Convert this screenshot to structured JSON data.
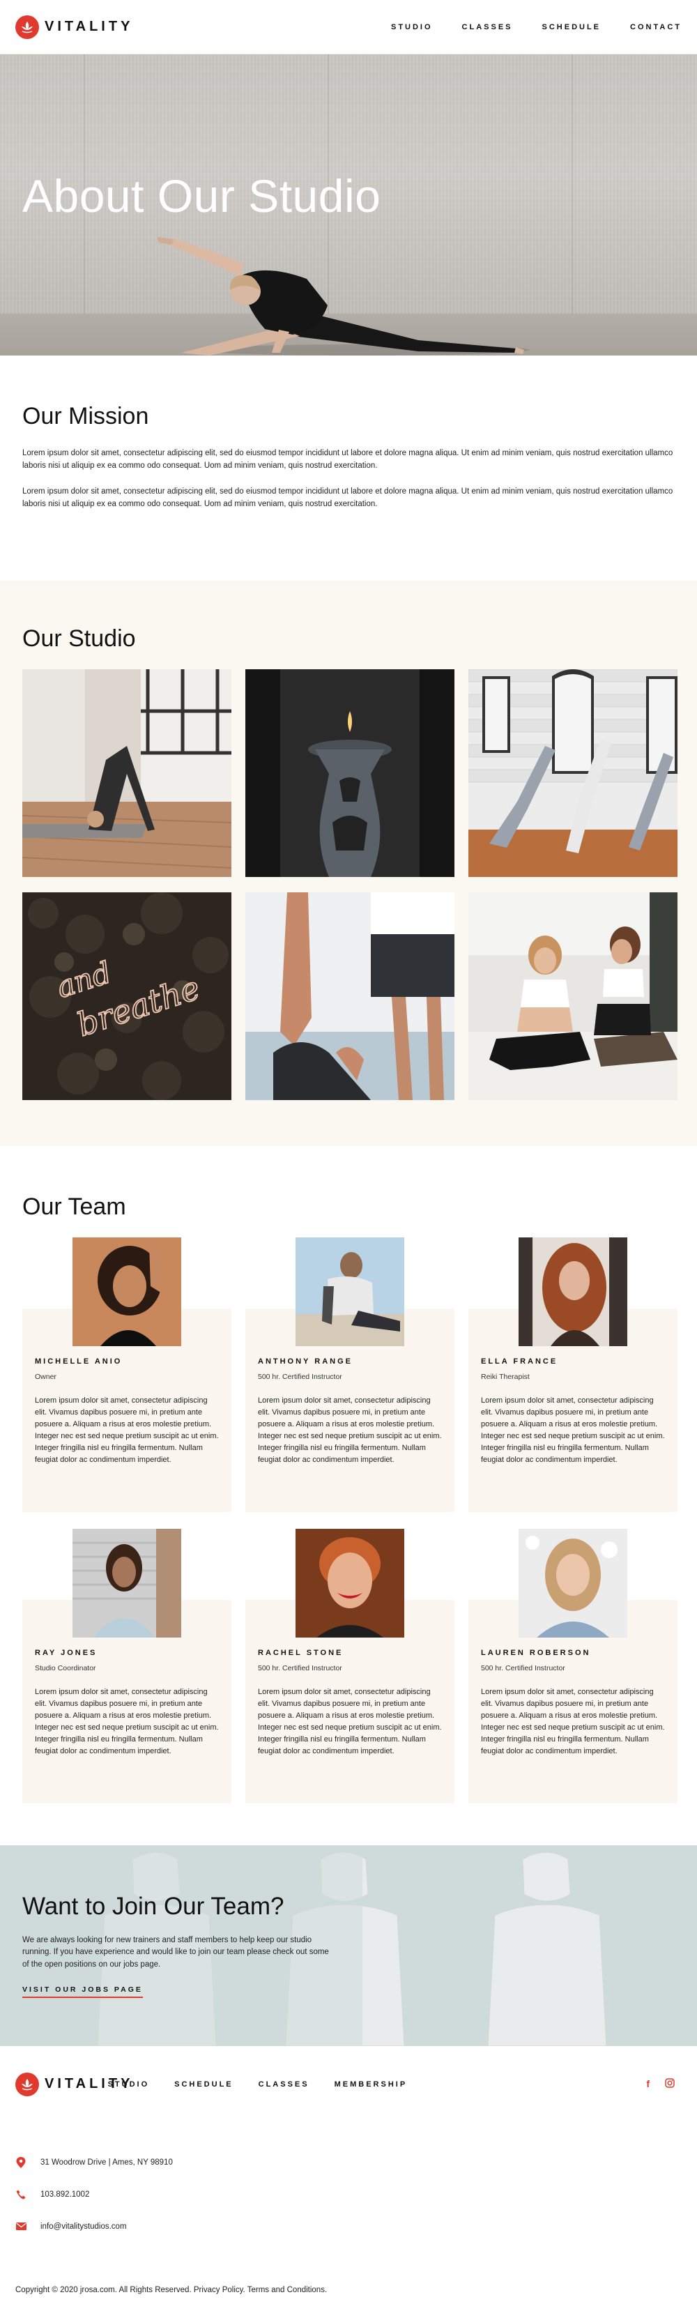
{
  "header": {
    "brand": "VITALITY",
    "nav": [
      "STUDIO",
      "CLASSES",
      "SCHEDULE",
      "CONTACT"
    ]
  },
  "hero": {
    "title": "About Our Studio"
  },
  "mission": {
    "title": "Our Mission",
    "paragraphs": [
      "Lorem ipsum dolor sit amet, consectetur adipiscing elit, sed do eiusmod tempor incididunt ut labore et dolore magna aliqua. Ut enim ad minim veniam, quis nostrud exercitation ullamco laboris nisi ut aliquip ex ea commo odo consequat. Uom ad minim veniam, quis nostrud exercitation.",
      "Lorem ipsum dolor sit amet, consectetur adipiscing elit, sed do eiusmod tempor incididunt ut labore et dolore magna aliqua. Ut enim ad minim veniam, quis nostrud exercitation ullamco laboris nisi ut aliquip ex ea commo odo consequat. Uom ad minim veniam, quis nostrud exercitation."
    ]
  },
  "studio": {
    "title": "Our Studio",
    "photos": [
      "downward-dog-yoga",
      "candle-holder",
      "handstand-class",
      "and-breathe-neon-sign",
      "partner-stretch",
      "women-stretching"
    ],
    "neon": [
      "and",
      "breathe"
    ]
  },
  "team": {
    "title": "Our Team",
    "bio": "Lorem ipsum dolor sit amet, consectetur adipiscing elit. Vivamus dapibus posuere mi, in pretium ante posuere a. Aliquam a risus at eros molestie pretium. Integer nec est sed neque pretium suscipit ac ut enim. Integer fringilla nisl eu fringilla fermentum. Nullam feugiat dolor ac condimentum imperdiet.",
    "members": [
      {
        "name": "MICHELLE ANIO",
        "role": "Owner"
      },
      {
        "name": "ANTHONY RANGE",
        "role": "500 hr. Certified Instructor"
      },
      {
        "name": "ELLA FRANCE",
        "role": "Reiki Therapist"
      },
      {
        "name": "RAY JONES",
        "role": "Studio Coordinator"
      },
      {
        "name": "RACHEL STONE",
        "role": "500 hr. Certified Instructor"
      },
      {
        "name": "LAUREN ROBERSON",
        "role": "500 hr. Certified Instructor"
      }
    ]
  },
  "join": {
    "title": "Want to Join Our Team?",
    "text": "We are always looking for new trainers and staff members to help keep our studio running. If you have experience and would like to join our team please check out some of the open positions on our jobs page.",
    "link": "VISIT OUR JOBS PAGE"
  },
  "footer": {
    "brand": "VITALITY",
    "nav": [
      "STUDIO",
      "SCHEDULE",
      "CLASSES",
      "MEMBERSHIP"
    ],
    "social": [
      "facebook-icon",
      "instagram-icon"
    ],
    "address": "31 Woodrow Drive | Ames, NY 98910",
    "phone": "103.892.1002",
    "email": "info@vitalitystudios.com",
    "copyright": "Copyright © 2020 jrosa.com. All Rights Reserved. Privacy Policy. Terms and Conditions."
  },
  "colors": {
    "accent": "#e03a2f",
    "cream": "#fbf8f2"
  }
}
